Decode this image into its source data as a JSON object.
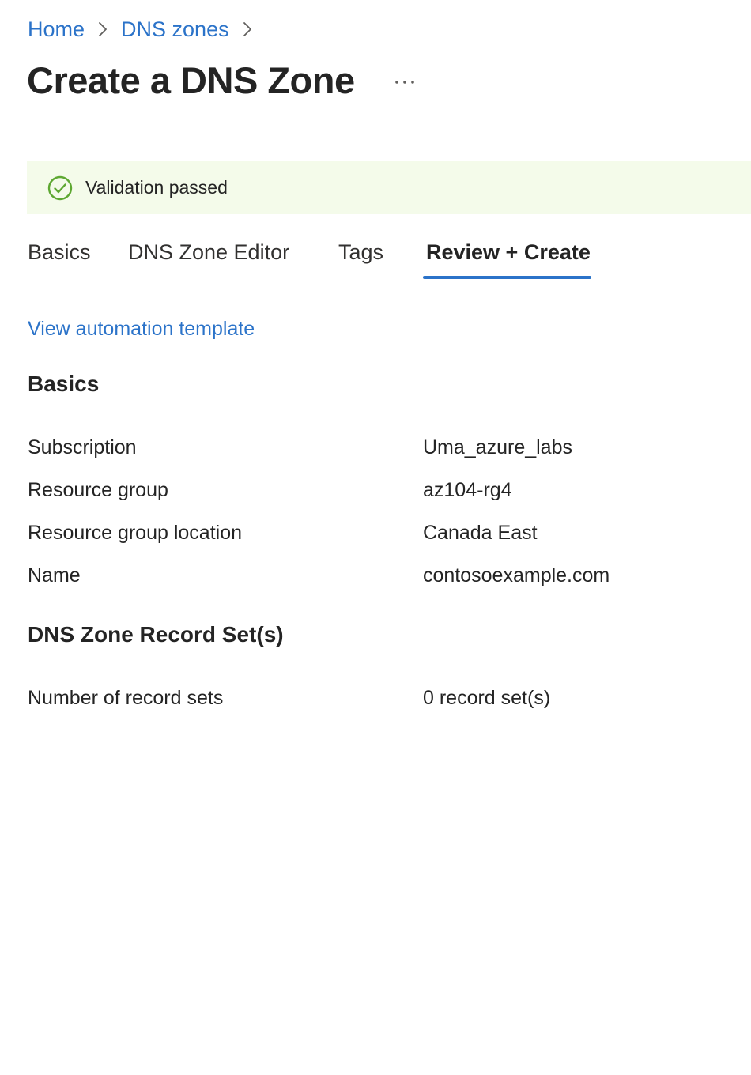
{
  "breadcrumb": {
    "items": [
      "Home",
      "DNS zones"
    ]
  },
  "page": {
    "title": "Create a DNS Zone",
    "more_label": "..."
  },
  "banner": {
    "icon": "check-circle-icon",
    "text": "Validation passed",
    "color": "#f4fbea",
    "icon_color": "#5ea832"
  },
  "tabs": [
    {
      "label": "Basics",
      "active": false
    },
    {
      "label": "DNS Zone Editor",
      "active": false
    },
    {
      "label": "Tags",
      "active": false
    },
    {
      "label": "Review + Create",
      "active": true
    }
  ],
  "links": {
    "automation": "View automation template"
  },
  "sections": {
    "basics": {
      "title": "Basics",
      "rows": [
        {
          "label": "Subscription",
          "value": "Uma_azure_labs"
        },
        {
          "label": "Resource group",
          "value": "az104-rg4"
        },
        {
          "label": "Resource group location",
          "value": "Canada East"
        },
        {
          "label": "Name",
          "value": "contosoexample.com"
        }
      ]
    },
    "records": {
      "title": "DNS Zone Record Set(s)",
      "rows": [
        {
          "label": "Number of record sets",
          "value": "0 record set(s)"
        }
      ]
    }
  },
  "colors": {
    "link": "#2b73c9",
    "text": "#242424",
    "tab_underline": "#2b73c9"
  }
}
